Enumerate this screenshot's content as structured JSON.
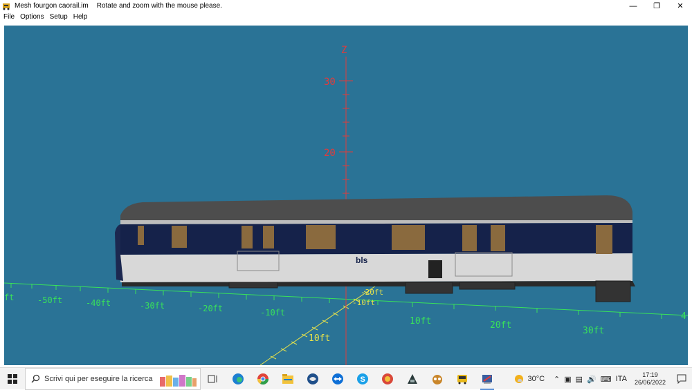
{
  "window": {
    "title": "Mesh fourgon caorail.im",
    "hint": "Rotate and zoom with the mouse please."
  },
  "menu": {
    "items": [
      "File",
      "Options",
      "Setup",
      "Help"
    ]
  },
  "viewport": {
    "background": "#2a7396",
    "z_axis": {
      "label": "Z",
      "ticks": [
        "30",
        "20"
      ]
    },
    "x_axis": {
      "ticks": [
        "ft",
        "-50ft",
        "-40ft",
        "-30ft",
        "-20ft",
        "-10ft",
        "10ft",
        "20ft",
        "30ft",
        "4"
      ]
    },
    "y_axis": {
      "ticks": [
        "-30ft",
        "-20ft",
        "-10ft",
        "10ft"
      ]
    },
    "vehicle": {
      "logo": "bls"
    },
    "colors": {
      "axis_z": "#e23b3b",
      "axis_x": "#39e25a",
      "axis_y": "#e8e34a",
      "body": "#15224a",
      "stripe": "#d8d8d8",
      "roof": "#4a4a4a"
    }
  },
  "taskbar": {
    "search_placeholder": "Scrivi qui per eseguire la ricerca",
    "apps": [
      "task-view-icon",
      "edge-icon",
      "chrome-icon",
      "file-explorer-icon",
      "app-globe-icon",
      "teamviewer-icon",
      "skype-icon",
      "app-red-icon",
      "app-dark-icon",
      "app-owl-icon",
      "app-bus-icon",
      "app-mesh-icon"
    ],
    "weather": "30°C",
    "language": "ITA",
    "time": "17:19",
    "date": "26/06/2022"
  }
}
